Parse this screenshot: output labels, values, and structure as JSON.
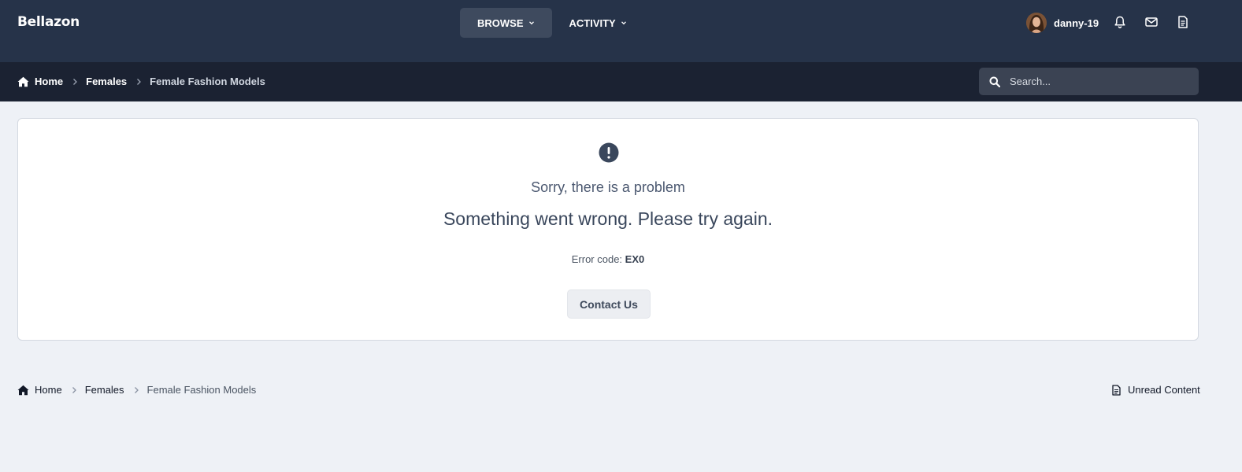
{
  "header": {
    "brand": "Bellazon",
    "nav": [
      {
        "label": "BROWSE",
        "active": true
      },
      {
        "label": "ACTIVITY",
        "active": false
      }
    ],
    "user": {
      "name": "danny-19"
    },
    "icons": [
      "bell-icon",
      "envelope-icon",
      "document-icon"
    ]
  },
  "breadcrumb": {
    "items": [
      "Home",
      "Females",
      "Female Fashion Models"
    ]
  },
  "search": {
    "placeholder": "Search..."
  },
  "error": {
    "title": "Sorry, there is a problem",
    "message": "Something went wrong. Please try again.",
    "code_label": "Error code:",
    "code": "EX0",
    "button": "Contact Us"
  },
  "footer": {
    "breadcrumb": [
      "Home",
      "Females",
      "Female Fashion Models"
    ],
    "unread_label": "Unread Content"
  },
  "colors": {
    "header_bg": "#263349",
    "crumbbar_bg": "#1b2232",
    "page_bg": "#eef1f6",
    "error_icon": "#3a475c"
  }
}
